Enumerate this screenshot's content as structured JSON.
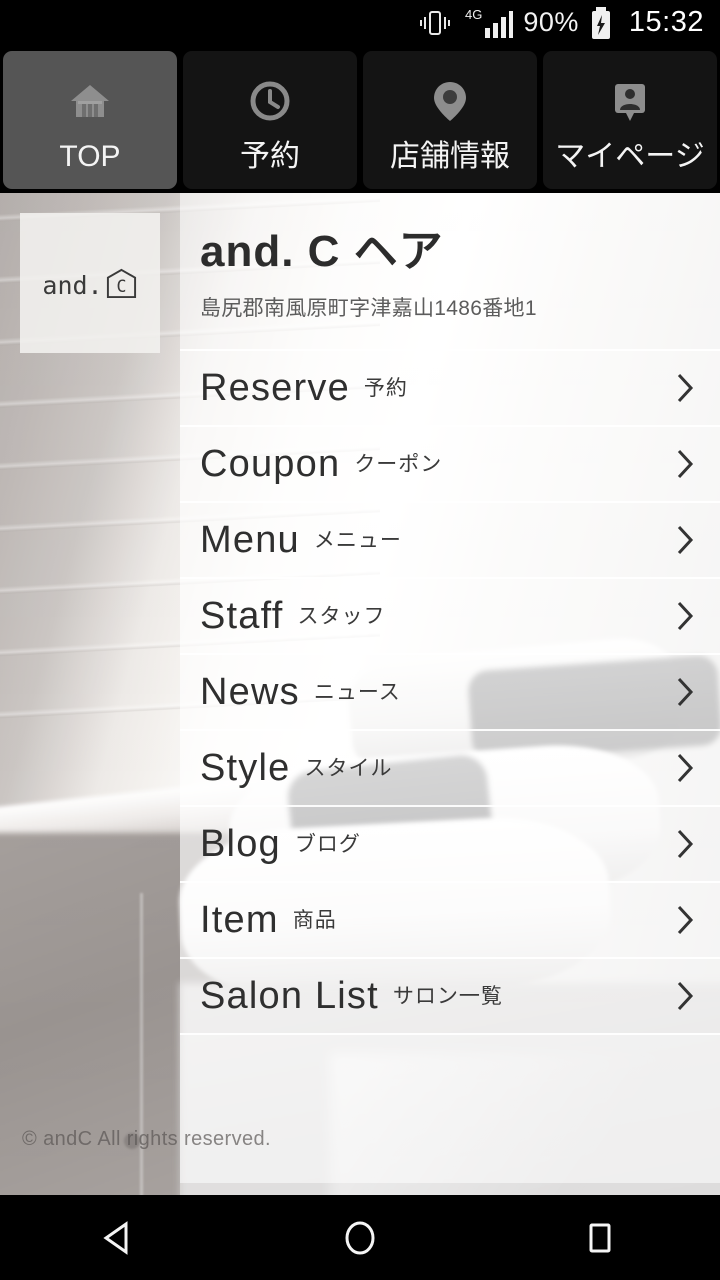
{
  "statusbar": {
    "vibrate_icon": "vibrate-icon",
    "network_label": "4G",
    "signal_icon": "signal-bars-icon",
    "battery_percent": "90%",
    "battery_icon": "battery-charging-icon",
    "clock": "15:32"
  },
  "tabbar": {
    "tabs": [
      {
        "label": "TOP",
        "icon": "home-icon",
        "active": true
      },
      {
        "label": "予約",
        "icon": "clock-icon",
        "active": false
      },
      {
        "label": "店舗情報",
        "icon": "map-pin-icon",
        "active": false
      },
      {
        "label": "マイページ",
        "icon": "contact-badge-icon",
        "active": false
      }
    ]
  },
  "logo": {
    "text": "and.",
    "badge_letter": "C",
    "icon": "house-outline-icon"
  },
  "header": {
    "salon_name": "and. C ヘア",
    "address": "島尻郡南風原町字津嘉山1486番地1"
  },
  "menu": {
    "chevron_icon": "chevron-right-icon",
    "items": [
      {
        "en": "Reserve",
        "ja": "予約"
      },
      {
        "en": "Coupon",
        "ja": "クーポン"
      },
      {
        "en": "Menu",
        "ja": "メニュー"
      },
      {
        "en": "Staff",
        "ja": "スタッフ"
      },
      {
        "en": "News",
        "ja": "ニュース"
      },
      {
        "en": "Style",
        "ja": "スタイル"
      },
      {
        "en": "Blog",
        "ja": "ブログ"
      },
      {
        "en": "Item",
        "ja": "商品"
      },
      {
        "en": "Salon List",
        "ja": "サロン一覧"
      }
    ]
  },
  "footer": {
    "copyright": "© andC All rights reserved."
  },
  "navbar": {
    "back_icon": "back-triangle-icon",
    "home_icon": "home-circle-icon",
    "recents_icon": "recents-square-icon"
  },
  "colors": {
    "status_bar_bg": "#000000",
    "tab_bg": "#141414",
    "tab_active_bg": "#555555",
    "tab_label": "#f4f4f4",
    "title_text": "#2c2c2c",
    "row_text": "#2f2f2f",
    "address_text": "#5c5c5c",
    "panel_overlay": "rgba(255,255,255,0.45)"
  }
}
